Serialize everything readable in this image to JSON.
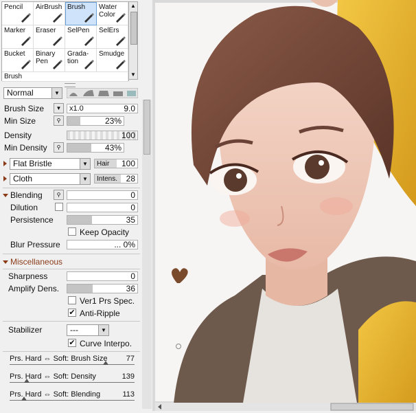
{
  "tools": [
    {
      "label": "Pencil",
      "icon": "pencil-icon",
      "selected": false
    },
    {
      "label": "AirBrush",
      "icon": "airbrush-icon",
      "selected": false
    },
    {
      "label": "Brush",
      "icon": "brush-icon",
      "selected": true
    },
    {
      "label": "Water Color",
      "icon": "watercolor-icon",
      "selected": false
    },
    {
      "label": "Marker",
      "icon": "marker-icon",
      "selected": false
    },
    {
      "label": "Eraser",
      "icon": "eraser-icon",
      "selected": false
    },
    {
      "label": "SelPen",
      "icon": "selpen-icon",
      "selected": false
    },
    {
      "label": "SelErs",
      "icon": "selers-icon",
      "selected": false
    },
    {
      "label": "Bucket",
      "icon": "bucket-icon",
      "selected": false
    },
    {
      "label": "Binary Pen",
      "icon": "binary-pen-icon",
      "selected": false
    },
    {
      "label": "Grada- tion",
      "icon": "gradation-icon",
      "selected": false
    },
    {
      "label": "Smudge",
      "icon": "smudge-icon",
      "selected": false
    },
    {
      "label": "Brush",
      "icon": "",
      "selected": false
    }
  ],
  "blend_mode": "Normal",
  "brush_size": {
    "label": "Brush Size",
    "multiplier": "x1.0",
    "value": "9.0"
  },
  "min_size": {
    "label": "Min Size",
    "value": "23%",
    "fraction": 0.23
  },
  "density": {
    "label": "Density",
    "value": "100",
    "fraction": 1.0
  },
  "min_density": {
    "label": "Min Density",
    "value": "43%",
    "fraction": 0.43
  },
  "texture1": {
    "name": "Flat Bristle",
    "param_label": "Hair",
    "value": "100"
  },
  "texture2": {
    "name": "Cloth",
    "param_label": "Intens.",
    "value": "28"
  },
  "blending": {
    "label": "Blending",
    "value": "0",
    "fraction": 0.0
  },
  "dilution": {
    "label": "Dilution",
    "value": "0",
    "fraction": 0.0
  },
  "persistence": {
    "label": "Persistence",
    "value": "35",
    "fraction": 0.35
  },
  "keep_opacity": {
    "label": "Keep Opacity",
    "checked": false
  },
  "blur_pressure": {
    "label": "Blur Pressure",
    "value": "... 0%"
  },
  "misc": {
    "title": "Miscellaneous",
    "sharpness": {
      "label": "Sharpness",
      "value": "0",
      "fraction": 0.0
    },
    "amplify": {
      "label": "Amplify Dens.",
      "value": "36",
      "fraction": 0.36
    },
    "ver1": {
      "label": "Ver1 Prs Spec.",
      "checked": false
    },
    "anti_ripple": {
      "label": "Anti-Ripple",
      "checked": true
    }
  },
  "stabilizer": {
    "label": "Stabilizer",
    "value": "---"
  },
  "curve_interpo": {
    "label": "Curve Interpo.",
    "checked": true
  },
  "pressure": [
    {
      "label": "Prs. Hard ⇔ Soft: Brush Size",
      "value": "77",
      "fraction": 0.77
    },
    {
      "label": "Prs. Hard ⇔ Soft: Density",
      "value": "139",
      "fraction": 0.139
    },
    {
      "label": "Prs. Hard ⇔ Soft: Blending",
      "value": "113",
      "fraction": 0.113
    }
  ]
}
